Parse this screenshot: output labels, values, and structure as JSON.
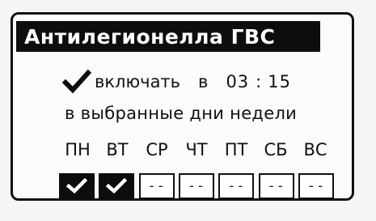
{
  "title": "Антилегионелла ГВС",
  "enable": {
    "checked": true,
    "label": "включать",
    "at_label": "в",
    "hours": "03",
    "colon": ":",
    "minutes": "15"
  },
  "subtitle": "в выбранные дни недели",
  "days": [
    {
      "label": "ПН",
      "checked": true,
      "text": ""
    },
    {
      "label": "ВТ",
      "checked": true,
      "text": ""
    },
    {
      "label": "СР",
      "checked": false,
      "text": "--"
    },
    {
      "label": "ЧТ",
      "checked": false,
      "text": "--"
    },
    {
      "label": "ПТ",
      "checked": false,
      "text": "--"
    },
    {
      "label": "СБ",
      "checked": false,
      "text": "--"
    },
    {
      "label": "ВС",
      "checked": false,
      "text": "--"
    }
  ]
}
